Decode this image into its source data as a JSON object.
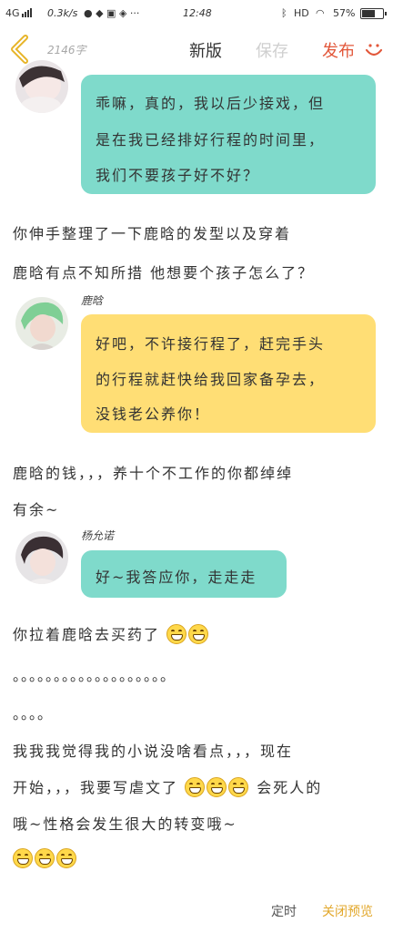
{
  "status_bar": {
    "network": "4G",
    "speed": "0.3k/s",
    "time": "12:48",
    "hd": "HD",
    "battery": "57%",
    "battery_level": 0.57
  },
  "header": {
    "word_count": "2146字",
    "new_version_label": "新版",
    "save_label": "保存",
    "publish_label": "发布"
  },
  "story": {
    "bubble1": {
      "lines": [
        "乖嘛，真的，我以后少接戏，但",
        "是在我已经排好行程的时间里，",
        "我们不要孩子好不好？"
      ]
    },
    "narration1": [
      "你伸手整理了一下鹿晗的发型以及穿着",
      "鹿晗有点不知所措 他想要个孩子怎么了？"
    ],
    "speaker2": "鹿晗",
    "bubble2": {
      "lines": [
        "好吧，不许接行程了，赶完手头",
        "的行程就赶快给我回家备孕去，",
        "没钱老公养你！"
      ]
    },
    "narration2": [
      "鹿晗的钱，，，养十个不工作的你都绰绰",
      "有余~"
    ],
    "speaker3": "杨允诺",
    "bubble3": {
      "lines": [
        "好~我答应你，走走走"
      ]
    },
    "narration3": "你拉着鹿晗去买药了",
    "dots1": "。。。。。。。。。。。。。。。。。。。",
    "dots2": "。。。。",
    "narration4": [
      "我我我觉得我的小说没啥看点，，，现在",
      "开始，，，我要写虐文了",
      "会死人的",
      "哦~性格会发生很大的转变哦~"
    ]
  },
  "footer": {
    "timer_label": "定时",
    "close_preview_label": "关闭预览"
  },
  "icons": {
    "back": "chevron-left-icon",
    "smile": "smile-icon",
    "emoji": "grin-emoji-icon"
  },
  "colors": {
    "teal_bubble": "#7fdacb",
    "yellow_bubble": "#ffde75",
    "publish": "#e2573a",
    "close_preview": "#e2a72a",
    "back_icon": "#e7b428"
  }
}
